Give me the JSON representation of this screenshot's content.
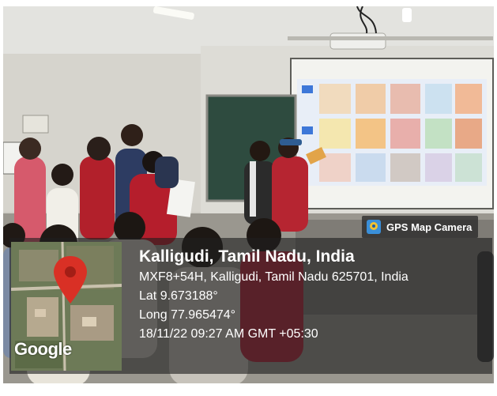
{
  "overlay": {
    "app_label": "GPS Map Camera",
    "place": "Kalligudi, Tamil Nadu, India",
    "address": "MXF8+54H, Kalligudi, Tamil Nadu 625701, India",
    "latitude": "Lat 9.673188°",
    "longitude": "Long 77.965474°",
    "timestamp": "18/11/22 09:27 AM GMT +05:30",
    "map_brand": "Google",
    "icons": [
      "gps-map-camera-logo-icon",
      "map-pin-icon"
    ],
    "colors": {
      "panel": "#1e1e1e",
      "text": "#ffffff",
      "pin": "#d93025"
    }
  }
}
